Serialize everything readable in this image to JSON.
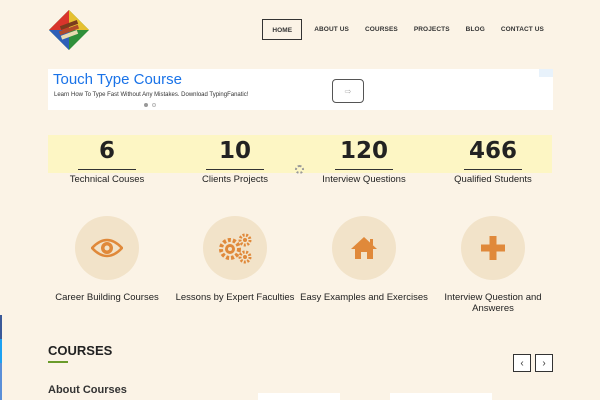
{
  "header": {
    "logo_icon": "books-logo-icon",
    "nav": [
      "HOME",
      "ABOUT US",
      "COURSES",
      "PROJECTS",
      "BLOG",
      "CONTACT US"
    ],
    "active_nav": "HOME"
  },
  "ad": {
    "title": "Touch Type Course",
    "description": "Learn How To Type Fast Without Any Mistakes. Download TypingFanatic!",
    "button_icon": "arrow-right-icon"
  },
  "stats": [
    {
      "number": "6",
      "label": "Technical Couses"
    },
    {
      "number": "10",
      "label": "Clients Projects"
    },
    {
      "number": "120",
      "label": "Interview Questions"
    },
    {
      "number": "466",
      "label": "Qualified Students"
    }
  ],
  "features": [
    {
      "icon": "eye-icon",
      "label": "Career Building Courses"
    },
    {
      "icon": "gears-icon",
      "label": "Lessons by Expert Faculties"
    },
    {
      "icon": "home-icon",
      "label": "Easy Examples and Exercises"
    },
    {
      "icon": "plus-icon",
      "label": "Interview Question and Answeres"
    }
  ],
  "courses": {
    "title": "COURSES",
    "prev": "‹",
    "next": "›",
    "about": "About Courses"
  },
  "colors": {
    "background": "#fbf3e6",
    "accent_orange": "#e0893a",
    "stats_band": "#fdf6c4",
    "link_blue": "#1a73e8",
    "underline_green": "#6a9b2a"
  }
}
